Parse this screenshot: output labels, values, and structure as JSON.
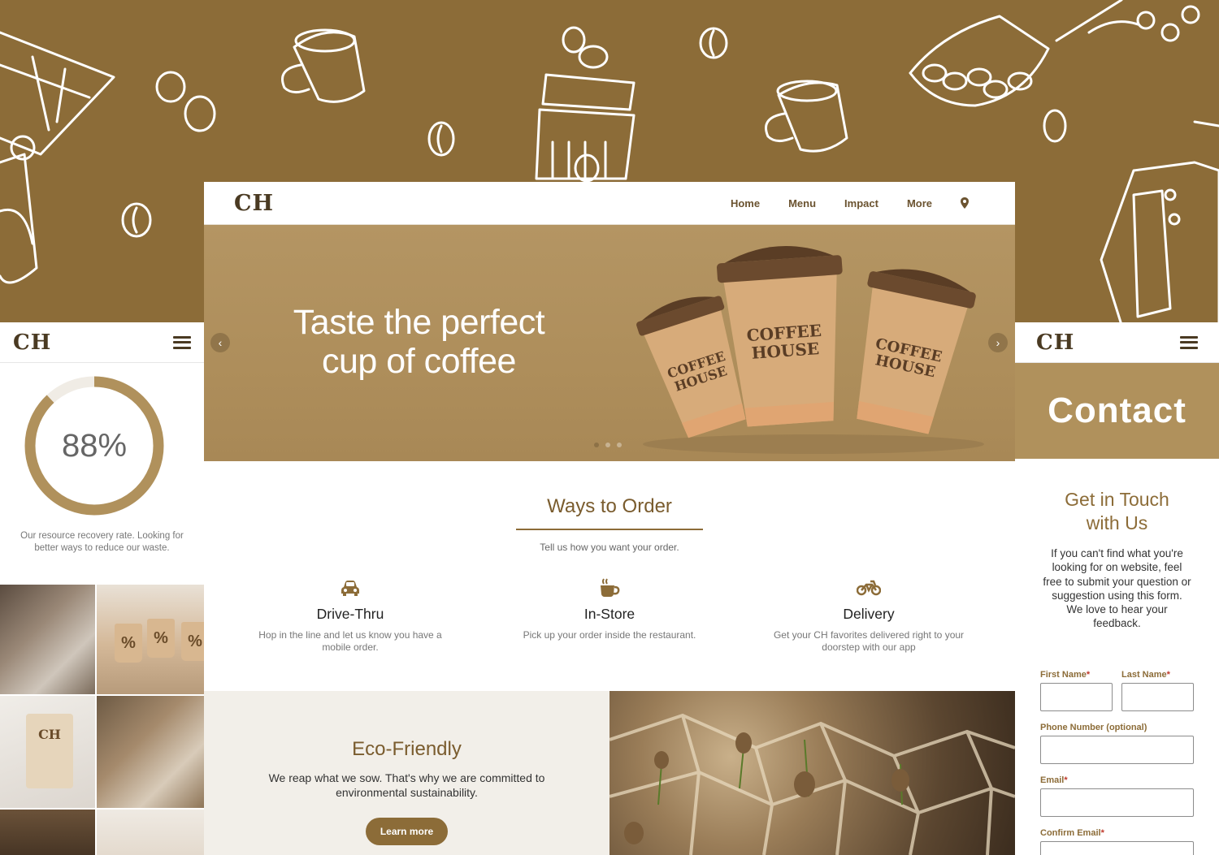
{
  "colors": {
    "brand": "#8c6c38",
    "brand_light": "#b0915c",
    "hero": "#b49563",
    "panel_bg": "#f2efe9",
    "required": "#c0392b"
  },
  "logo": "CH",
  "nav": {
    "items": [
      "Home",
      "Menu",
      "Impact",
      "More"
    ],
    "location_icon": "map-pin-icon"
  },
  "hero": {
    "title_line1": "Taste the perfect",
    "title_line2": "cup of coffee",
    "cup_label_line1": "COFFEE",
    "cup_label_line2": "HOUSE",
    "slides": 3,
    "active_slide": 1
  },
  "ways": {
    "title": "Ways to Order",
    "subtitle": "Tell us how you want your order.",
    "options": [
      {
        "icon": "car-icon",
        "title": "Drive-Thru",
        "desc": "Hop in the line and let us know you have a mobile order."
      },
      {
        "icon": "coffee-cup-icon",
        "title": "In-Store",
        "desc": "Pick up your order inside the restaurant."
      },
      {
        "icon": "motorcycle-icon",
        "title": "Delivery",
        "desc": "Get your CH favorites delivered right to your doorstep with our app"
      }
    ]
  },
  "eco": {
    "title": "Eco-Friendly",
    "text": "We reap what we sow. That's why we are committed to environmental sustainability.",
    "button": "Learn more"
  },
  "impact_mobile": {
    "logo": "CH",
    "percent_text": "88%",
    "percent_value": 88,
    "caption": "Our resource recovery rate. Looking for better ways to reduce our waste.",
    "bag_label": "CH",
    "cup_symbol": "%"
  },
  "contact_mobile": {
    "logo": "CH",
    "banner": "Contact",
    "heading_line1": "Get in Touch",
    "heading_line2": "with Us",
    "text": "If you can't find what you're looking for on website, feel free to submit your question or suggestion using this form. We love to hear your feedback.",
    "fields": {
      "first_name": "First Name",
      "last_name": "Last Name",
      "phone": "Phone Number (optional)",
      "email": "Email",
      "confirm_email": "Confirm Email"
    },
    "required_mark": "*"
  }
}
